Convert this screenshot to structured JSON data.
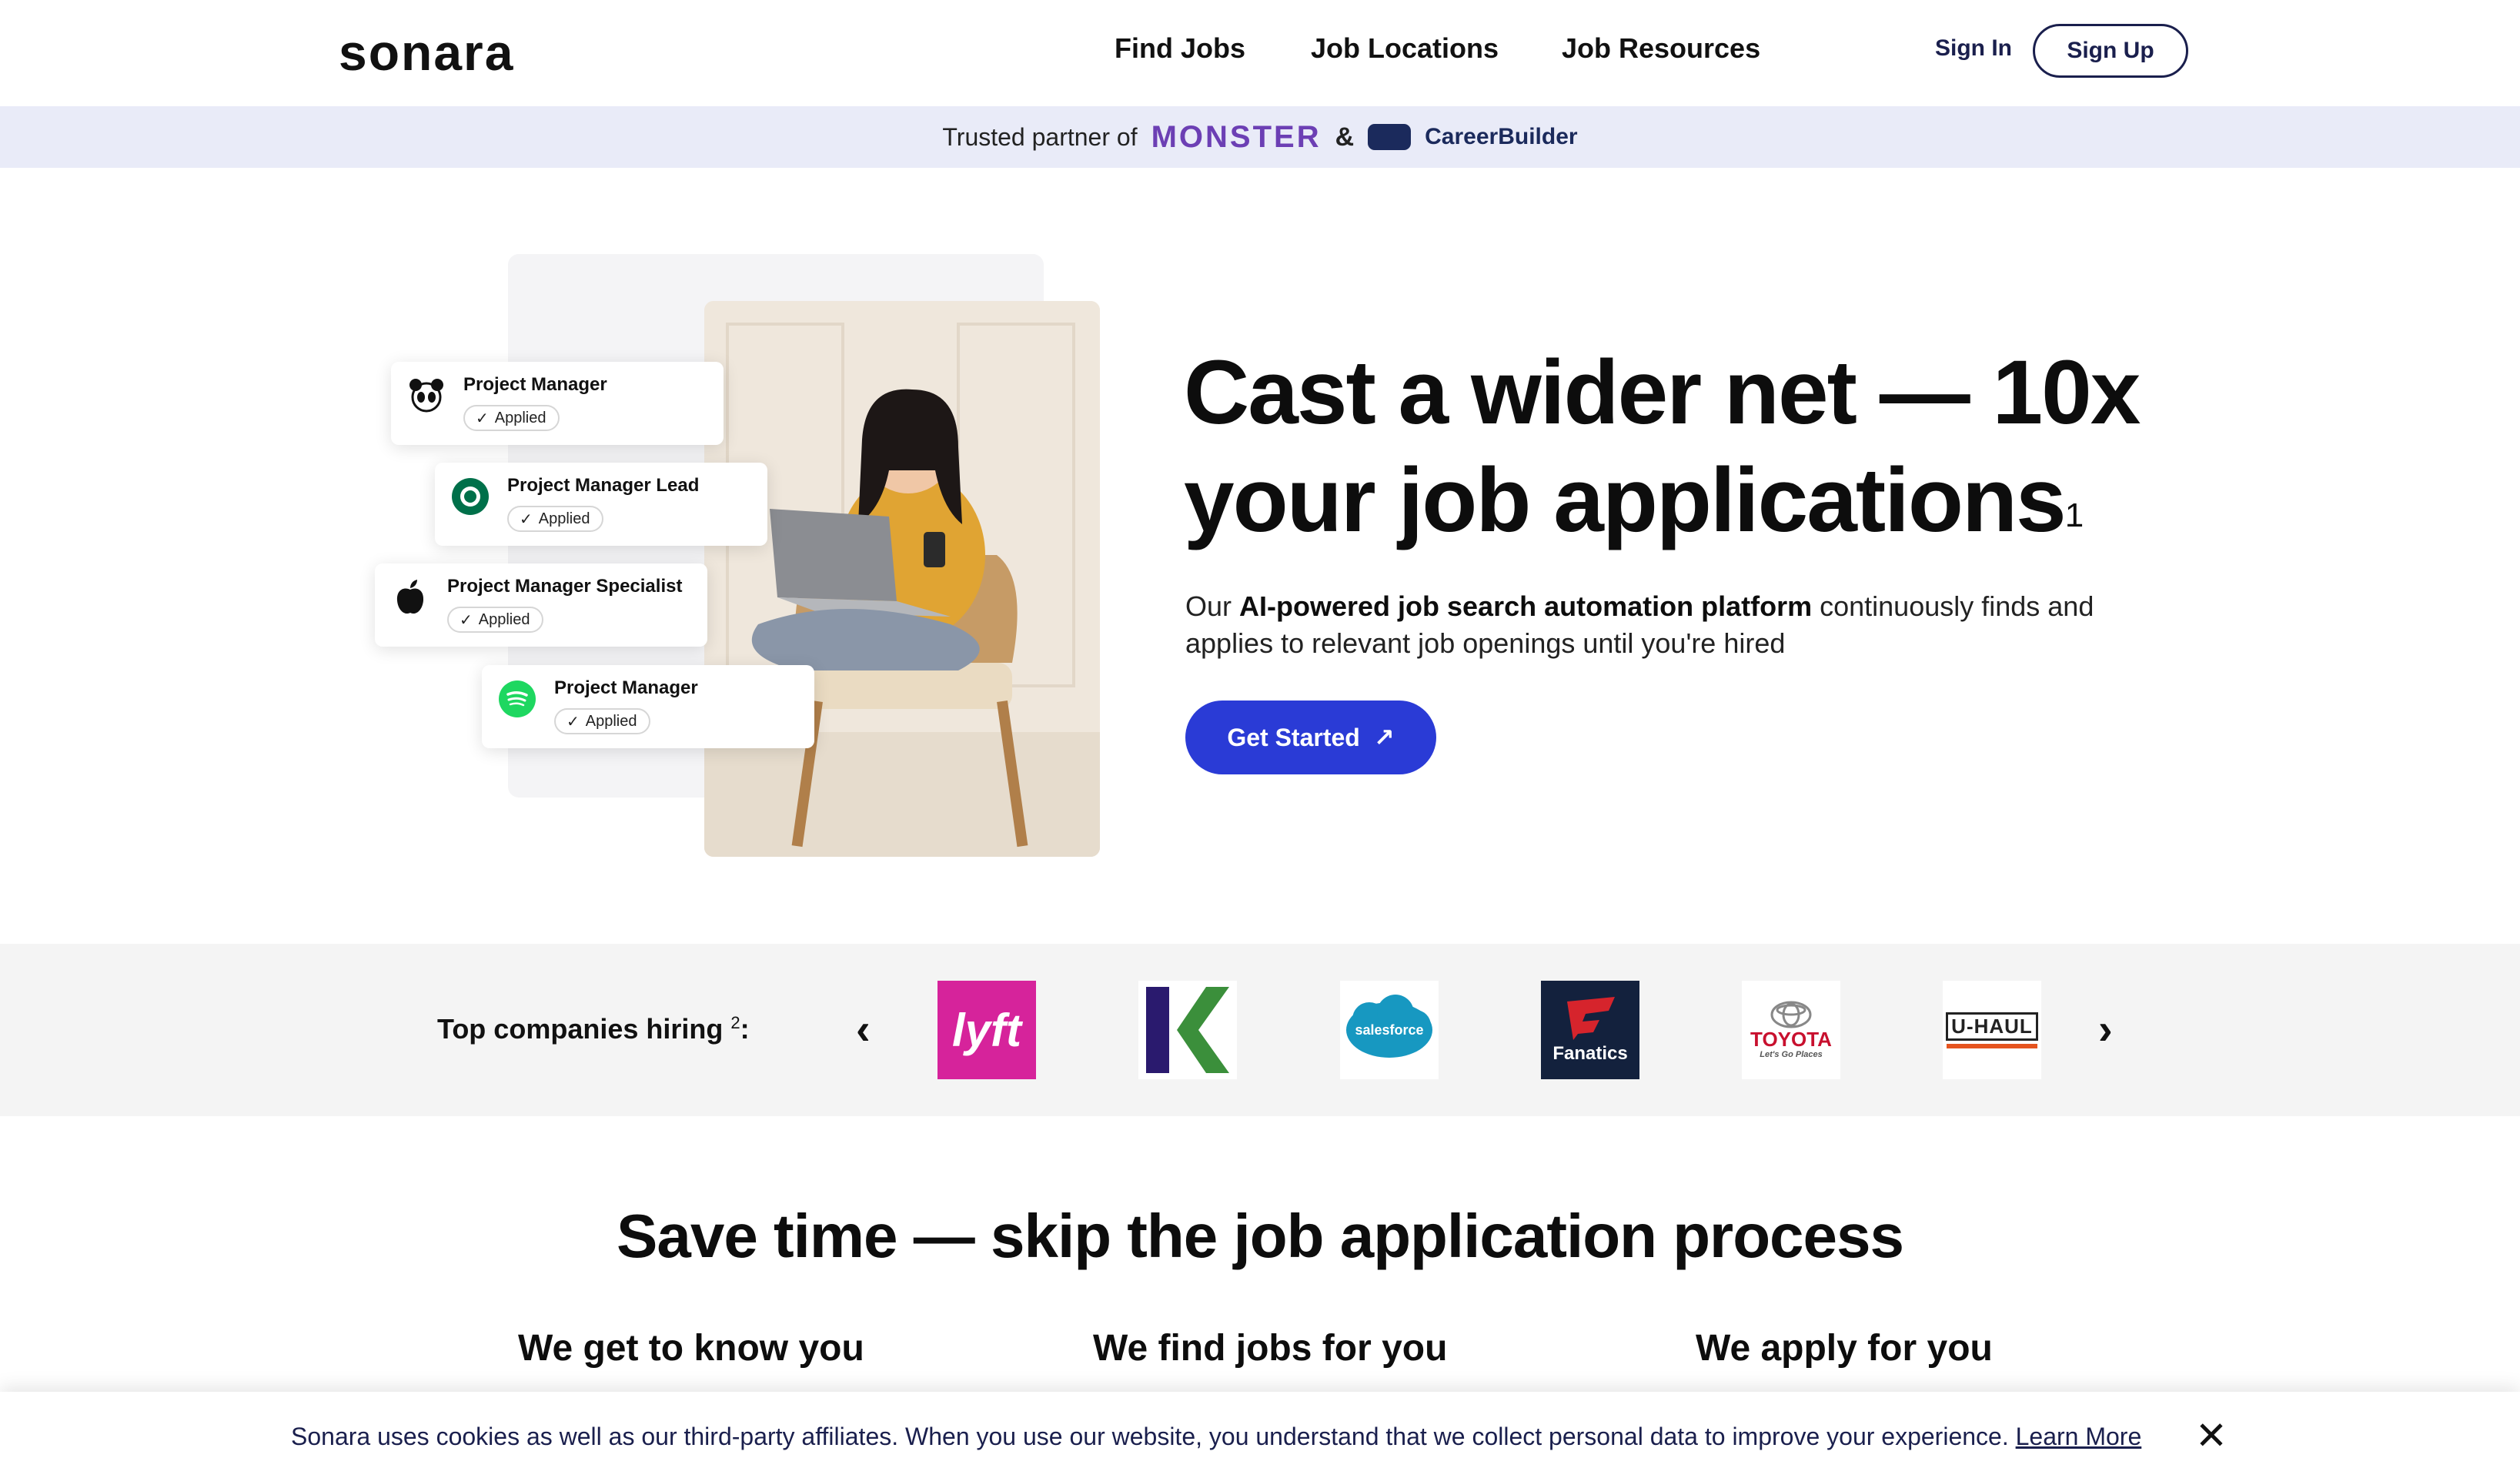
{
  "header": {
    "logo": "sonara",
    "nav": [
      "Find Jobs",
      "Job Locations",
      "Job Resources"
    ],
    "sign_in": "Sign In",
    "sign_up": "Sign Up"
  },
  "partner_bar": {
    "text": "Trusted partner of",
    "monster": "MONSTER",
    "amp": "&",
    "careerbuilder": "CareerBuilder"
  },
  "hero": {
    "headline_line1": "Cast a wider net — 10x",
    "headline_line2": "your job applications",
    "headline_footnote": "1",
    "sub_prefix": "Our ",
    "sub_bold": "AI-powered job search automation platform",
    "sub_suffix": " continuously finds and applies to relevant job openings until you're hired",
    "cta_label": "Get Started",
    "job_cards": [
      {
        "title": "Project Manager",
        "status": "Applied",
        "logo": "panda-icon"
      },
      {
        "title": "Project Manager Lead",
        "status": "Applied",
        "logo": "starbucks-icon"
      },
      {
        "title": "Project Manager Specialist",
        "status": "Applied",
        "logo": "apple-icon"
      },
      {
        "title": "Project Manager",
        "status": "Applied",
        "logo": "spotify-icon"
      }
    ]
  },
  "companies": {
    "label": "Top companies hiring",
    "footnote": "2",
    "suffix": ":",
    "logos": [
      {
        "name": "lyft",
        "text": "lyft",
        "bg": "#d6239b",
        "fg": "#ffffff"
      },
      {
        "name": "kalshi",
        "text": "K",
        "bg": "#ffffff",
        "fg": "#2a1a6e"
      },
      {
        "name": "salesforce",
        "text": "salesforce",
        "bg": "#ffffff",
        "fg": "#ffffff"
      },
      {
        "name": "fanatics",
        "text": "Fanatics",
        "bg": "#13213d",
        "fg": "#ffffff"
      },
      {
        "name": "toyota",
        "text": "TOYOTA",
        "tagline": "Let's Go Places",
        "bg": "#ffffff",
        "fg": "#c8102e"
      },
      {
        "name": "uhaul",
        "text": "U-HAUL",
        "bg": "#ffffff",
        "fg": "#222222"
      }
    ]
  },
  "section2": {
    "title": "Save time — skip the job application process",
    "columns": [
      "We get to know you",
      "We find jobs for you",
      "We apply for you"
    ]
  },
  "cookie": {
    "text": "Sonara uses cookies as well as our third-party affiliates. When you use our website, you understand that we collect personal data to improve your experience.",
    "link": "Learn More"
  },
  "colors": {
    "accent": "#2a3bd6",
    "partner_bg": "#e9ebf8",
    "navy": "#1a1f4d",
    "monster": "#6c3fb4"
  }
}
